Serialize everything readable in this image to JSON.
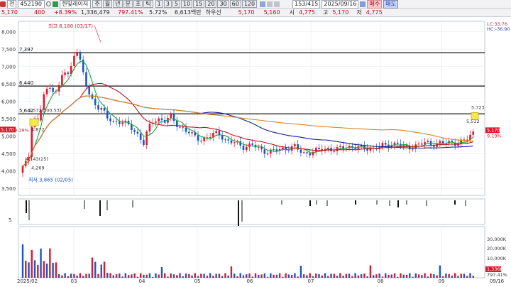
{
  "toolbar": {
    "rtype": "전",
    "code": "452190",
    "name": "한빛레이저",
    "periods": [
      "주",
      "월",
      "년",
      "분",
      "초",
      "틱"
    ],
    "ticks": [
      "1",
      "3",
      "5",
      "10",
      "15",
      "20",
      "30",
      "60",
      "120"
    ],
    "count": "153",
    "count_total": "/415",
    "date": "2025/09/16",
    "buy_label": "매수",
    "sell_label": "매도"
  },
  "quote": {
    "price": "5,170",
    "change": "400",
    "change_pct": "+8.39%",
    "volume": "1,336,479",
    "vol_ratio": "797.41%",
    "turnover": "5.72%",
    "amount": "6,613백만",
    "pref_label": "하우선",
    "ask": "5,170",
    "bid": "5,160",
    "open_label": "시",
    "open": "4,775",
    "high_label": "고",
    "high": "5,170",
    "low_label": "저",
    "low": "4,775"
  },
  "colors": {
    "up": "#e0162b",
    "down": "#1a56c4",
    "ma5": "#1aa33a",
    "ma20": "#c0141e",
    "ma60": "#1a1f8f",
    "ma120": "#d98324"
  },
  "chart_data": {
    "type": "candlestick",
    "x": [
      "2025/02",
      "03",
      "04",
      "05",
      "06",
      "07",
      "08",
      "09",
      "09/16"
    ],
    "y_ticks": [
      "8,000",
      "7,500",
      "7,000",
      "6,500",
      "6,000",
      "5,500",
      "5,000",
      "4,500",
      "4,000",
      "3,500"
    ],
    "ylim": [
      3300,
      8300
    ],
    "hlines": [
      {
        "label": "7,397",
        "value": 7397
      },
      {
        "label": "6,440",
        "value": 6440
      },
      {
        "label": "5,642",
        "value": 5642
      }
    ],
    "annotations": {
      "high": "최고 8,180 (03/17)",
      "low": "최저 3,865 (02/05)",
      "a1": "5,572(300.53)",
      "a2": "4,872",
      "a3": "4,143(25)",
      "a4": "4,269",
      "a5": "5,723",
      "a6": "5,512"
    },
    "right_labels": {
      "top": "LC:33.76",
      "top2": "HC:-36.90",
      "price": "5,170",
      "pct": "9.19%",
      "pct2": "9.19%"
    },
    "sub_ticks": [
      "5"
    ],
    "vol_ticks": [
      "30,000K",
      "20,000K",
      "10,000K"
    ],
    "vol_current": "1,336K",
    "vol_pct": "797.41%"
  }
}
